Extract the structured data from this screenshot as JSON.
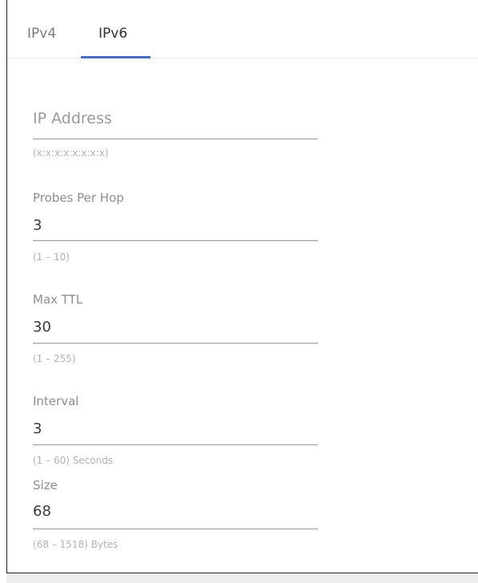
{
  "tabs": [
    {
      "label": "IPv4",
      "active": false
    },
    {
      "label": "IPv6",
      "active": true
    }
  ],
  "accent_color": "#4a6db5",
  "fields": {
    "ip_address": {
      "label": "IP Address",
      "value": "",
      "hint": "(x:x:x:x:x:x:x:x)"
    },
    "probes_per_hop": {
      "label": "Probes Per Hop",
      "value": "3",
      "hint": "(1 – 10)"
    },
    "max_ttl": {
      "label": "Max TTL",
      "value": "30",
      "hint": "(1 – 255)"
    },
    "interval": {
      "label": "Interval",
      "value": "3",
      "hint": "(1 – 60) Seconds"
    },
    "size": {
      "label": "Size",
      "value": "68",
      "hint": "(68 – 1518) Bytes"
    }
  }
}
